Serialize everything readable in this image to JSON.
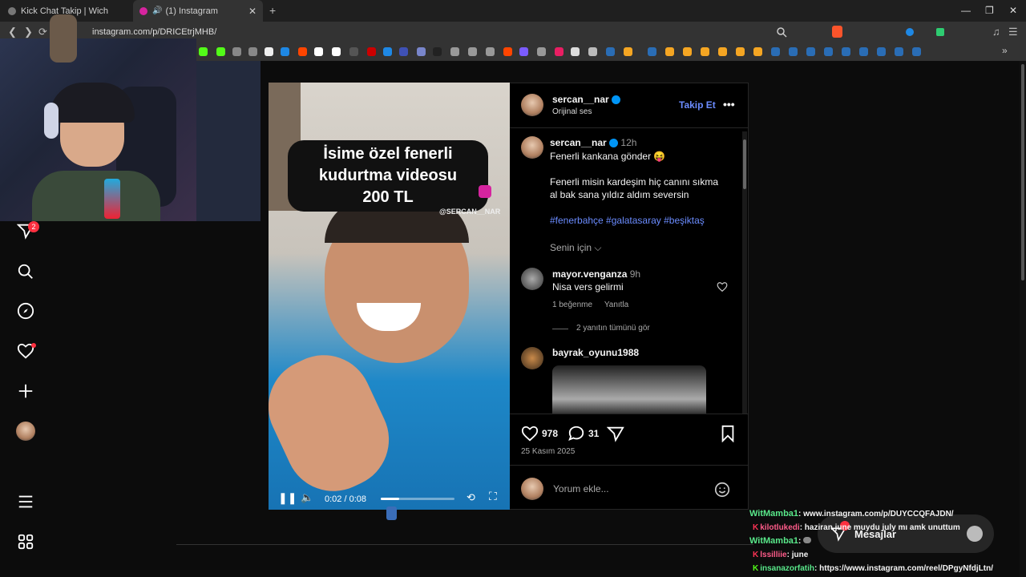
{
  "browser": {
    "tabs": [
      {
        "label": "Kick Chat Takip | Wich"
      },
      {
        "label": "(1) Instagram"
      }
    ],
    "url": "instagram.com/p/DRICEtrjMHB/"
  },
  "sidebar": {
    "notifications_badge": "2"
  },
  "video": {
    "overlay_text": [
      "İsime özel fenerli",
      "kudurtma videosu",
      "200 TL"
    ],
    "watermark": "@SERCAN__NAR",
    "time": "0:02 / 0:08",
    "progress": 0.25
  },
  "post": {
    "username": "sercan__nar",
    "audio": "Orijinal ses",
    "follow_label": "Takip Et",
    "caption_user": "sercan__nar",
    "caption_time": "12h",
    "caption_line1": "Fenerli kankana gönder 😝",
    "caption_line2": "Fenerli misin kardeşim hiç canını sıkma",
    "caption_line3": "al bak sana yıldız aldım seversin",
    "hashtags": "#fenerbahçe #galatasaray #beşiktaş",
    "for_you": "Senin için",
    "comments": [
      {
        "user": "mayor.venganza",
        "time": "9h",
        "text": "Nisa vers gelirmi",
        "likes": "1 beğenme",
        "reply": "Yanıtla",
        "view_replies": "2 yanıtın tümünü gör"
      },
      {
        "user": "bayrak_oyunu1988"
      }
    ],
    "likes": "978",
    "comments_count": "31",
    "date": "25 Kasım 2025",
    "comment_placeholder": "Yorum ekle..."
  },
  "chat": [
    {
      "user": "WitMamba1",
      "text": ": www.instagram.com/p/DUYCCQFAJDN/",
      "color": "#59e88a"
    },
    {
      "user": "kilotlukedi",
      "text": ": haziran june muydu july mı amk unuttum",
      "color": "#ff5c8a"
    },
    {
      "user": "WitMamba1",
      "text": ": ",
      "color": "#59e88a"
    },
    {
      "user": "lssilliie",
      "text": ": june",
      "color": "#ff5c8a"
    },
    {
      "user": "insanazorfatih",
      "text": ": https://www.instagram.com/reel/DPgyNfdjLtn/",
      "color": "#59e88a"
    }
  ],
  "messages": {
    "label": "Mesajlar"
  },
  "icons": [
    "search-icon",
    "explore-icon",
    "heart-icon",
    "plus-icon",
    "menu-icon",
    "grid-icon",
    "send-icon",
    "comment-icon",
    "bookmark-icon",
    "more-icon"
  ],
  "colors": {
    "instagram_blue": "#0095f6",
    "hashtag": "#e0f1ff",
    "follow": "#6b8cff",
    "badge": "#ff3040"
  }
}
